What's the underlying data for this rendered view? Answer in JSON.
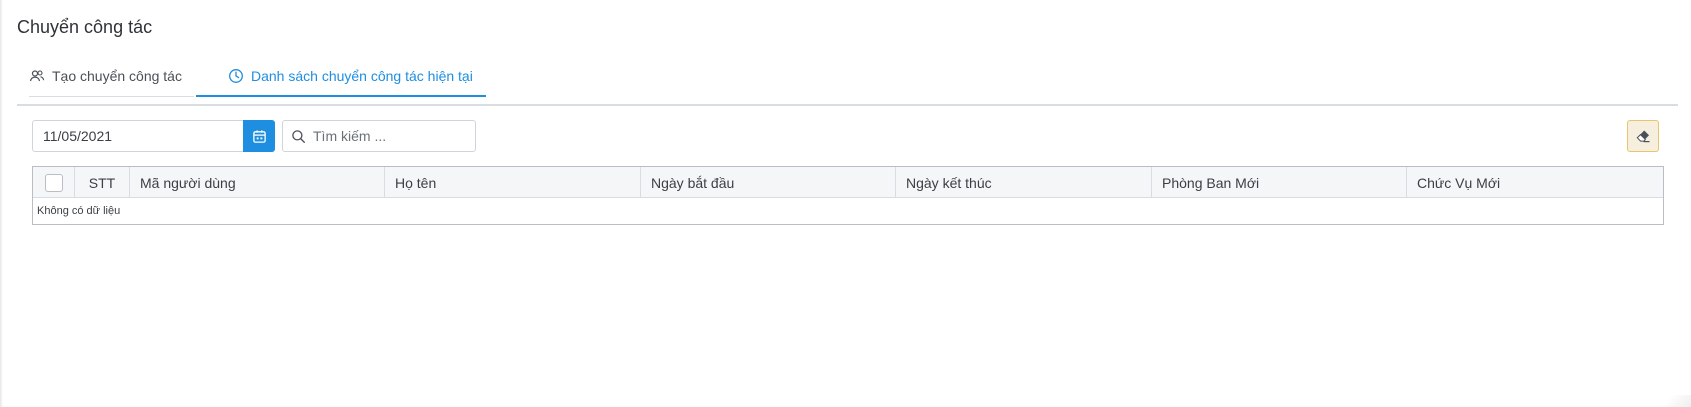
{
  "page": {
    "title": "Chuyển công tác"
  },
  "tabs": [
    {
      "label": "Tạo chuyển công tác",
      "icon": "users-icon",
      "active": false
    },
    {
      "label": "Danh sách chuyển công tác hiện tại",
      "icon": "clock-icon",
      "active": true
    }
  ],
  "filters": {
    "date_value": "11/05/2021",
    "date_button_icon": "calendar-icon",
    "search_placeholder": "Tìm kiếm ...",
    "search_value": "",
    "clear_button_icon": "eraser-icon"
  },
  "table": {
    "columns": [
      "STT",
      "Mã người dùng",
      "Họ tên",
      "Ngày bắt đầu",
      "Ngày kết thúc",
      "Phòng Ban Mới",
      "Chức Vụ Mới"
    ],
    "rows": [],
    "empty_text": "Không có dữ liệu"
  },
  "colors": {
    "accent": "#1e8ee0",
    "clear_button_bg": "#f6efdd",
    "clear_button_border": "#e8c56b",
    "header_bg": "#f5f6f8"
  }
}
